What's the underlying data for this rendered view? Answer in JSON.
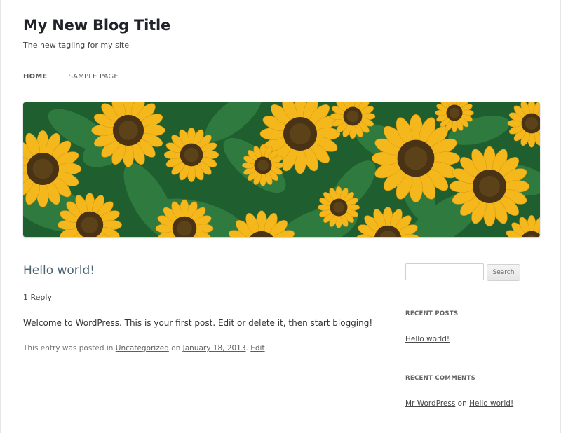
{
  "site": {
    "title": "My New Blog Title",
    "tagline": "The new tagling for my site"
  },
  "nav": {
    "items": [
      {
        "label": "HOME",
        "current": true
      },
      {
        "label": "SAMPLE PAGE",
        "current": false
      }
    ]
  },
  "post": {
    "title": "Hello world!",
    "reply_link": "1 Reply",
    "body": "Welcome to WordPress. This is your first post. Edit or delete it, then start blogging!",
    "meta": {
      "prefix": "This entry was posted in ",
      "category": "Uncategorized",
      "on": " on ",
      "date": "January 18, 2013",
      "period": ". ",
      "edit": "Edit"
    }
  },
  "sidebar": {
    "search": {
      "placeholder": "",
      "button_label": "Search"
    },
    "recent_posts": {
      "title": "RECENT POSTS",
      "items": [
        "Hello world!"
      ]
    },
    "recent_comments": {
      "title": "RECENT COMMENTS",
      "items": [
        {
          "author": "Mr WordPress",
          "on": " on ",
          "post": "Hello world!"
        }
      ]
    }
  },
  "colors": {
    "post_title": "#4b6474",
    "sunflower_petal": "#f5b81c",
    "sunflower_center": "#4a3314",
    "leaf": "#2f7a3e"
  },
  "header_image": {
    "icon": "sunflower-photo"
  }
}
